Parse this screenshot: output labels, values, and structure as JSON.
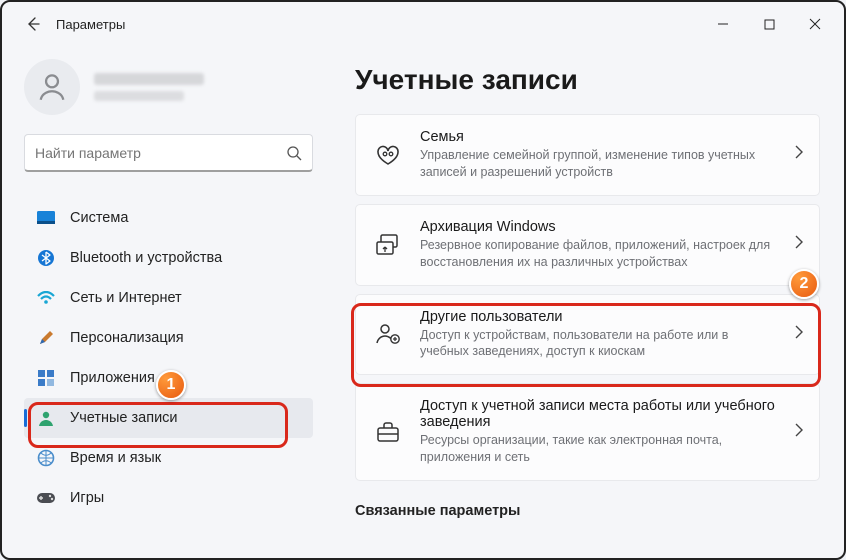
{
  "window": {
    "title": "Параметры"
  },
  "search": {
    "placeholder": "Найти параметр"
  },
  "sidebar": {
    "items": [
      {
        "label": "Система"
      },
      {
        "label": "Bluetooth и устройства"
      },
      {
        "label": "Сеть и Интернет"
      },
      {
        "label": "Персонализация"
      },
      {
        "label": "Приложения"
      },
      {
        "label": "Учетные записи"
      },
      {
        "label": "Время и язык"
      },
      {
        "label": "Игры"
      }
    ]
  },
  "page": {
    "title": "Учетные записи",
    "related_heading": "Связанные параметры",
    "cards": [
      {
        "title": "Семья",
        "desc": "Управление семейной группой, изменение типов учетных записей и разрешений устройств"
      },
      {
        "title": "Архивация Windows",
        "desc": "Резервное копирование файлов, приложений, настроек для восстановления их на различных устройствах"
      },
      {
        "title": "Другие пользователи",
        "desc": "Доступ к устройствам, пользователи на работе или в учебных заведениях, доступ к киоскам"
      },
      {
        "title": "Доступ к учетной записи места работы или учебного заведения",
        "desc": "Ресурсы организации, такие как электронная почта, приложения и сеть"
      }
    ]
  },
  "badges": {
    "one": "1",
    "two": "2"
  }
}
